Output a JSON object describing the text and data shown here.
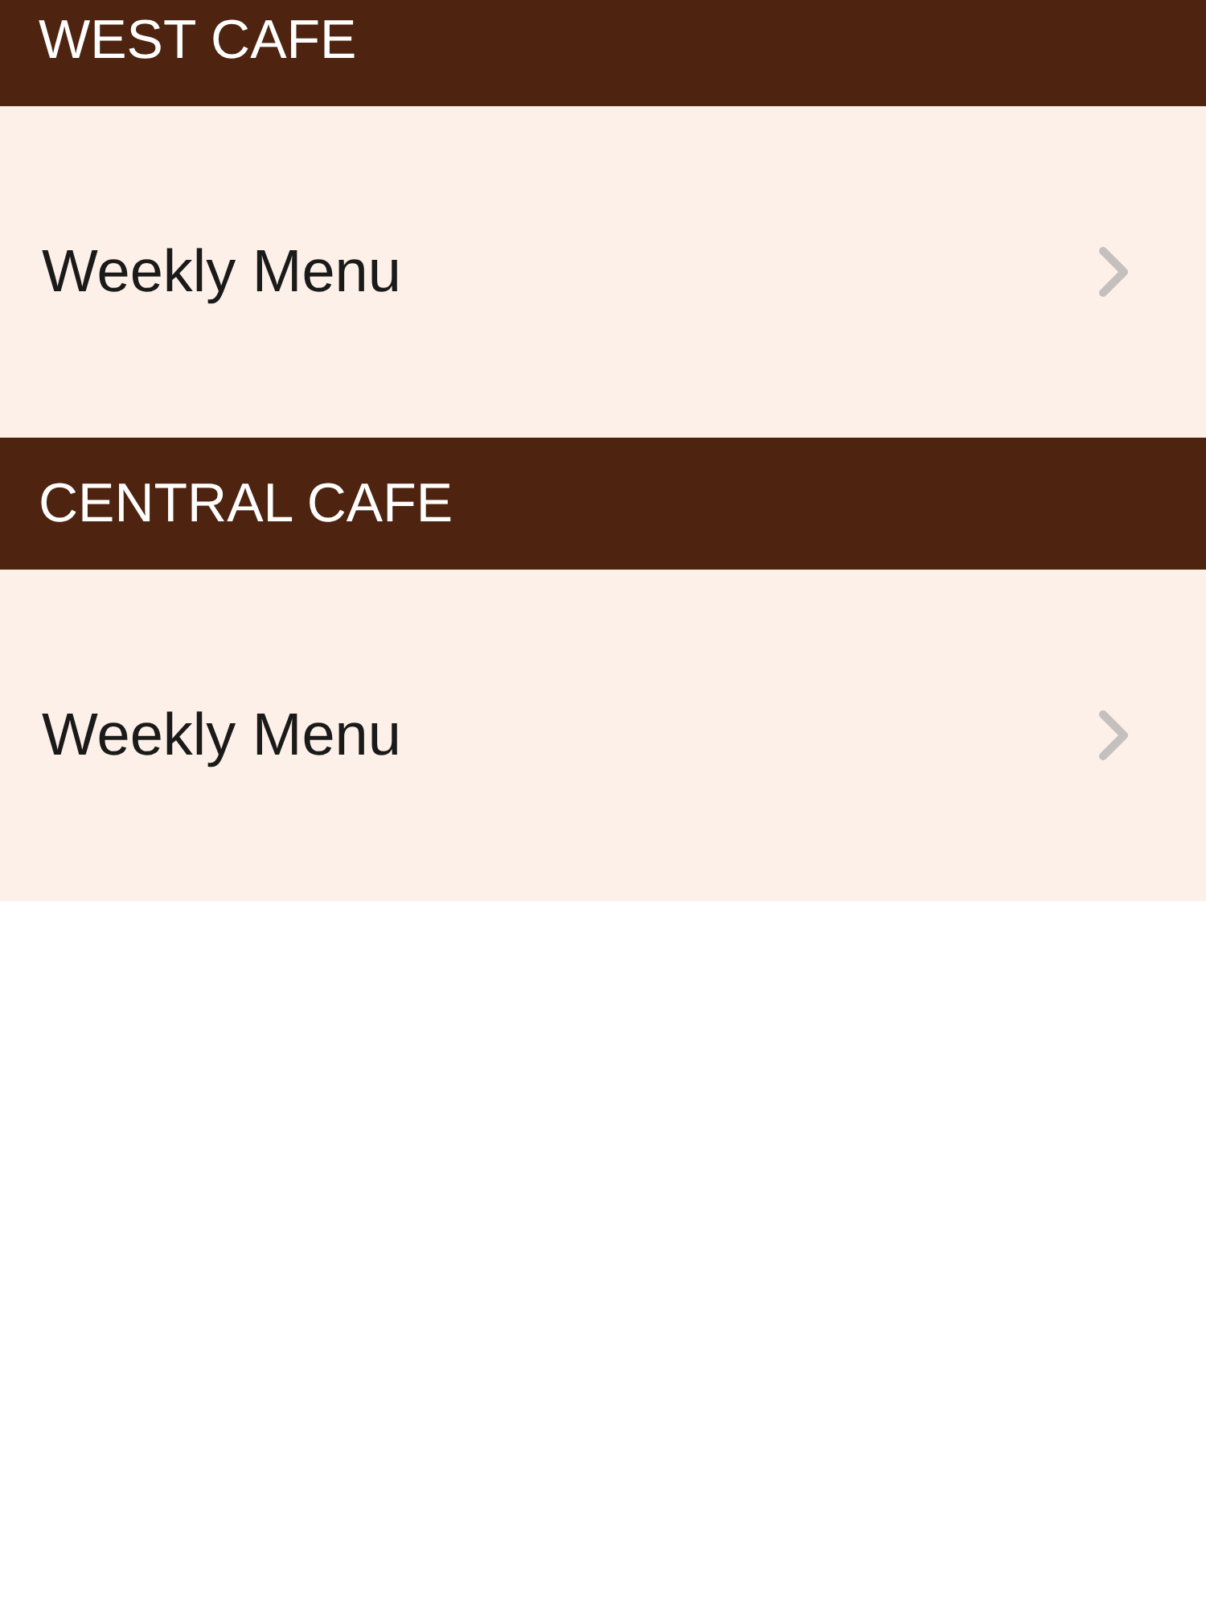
{
  "sections": [
    {
      "title": "WEST CAFE",
      "items": [
        {
          "label": "Weekly Menu"
        }
      ]
    },
    {
      "title": "CENTRAL CAFE",
      "items": [
        {
          "label": "Weekly Menu"
        }
      ]
    }
  ]
}
